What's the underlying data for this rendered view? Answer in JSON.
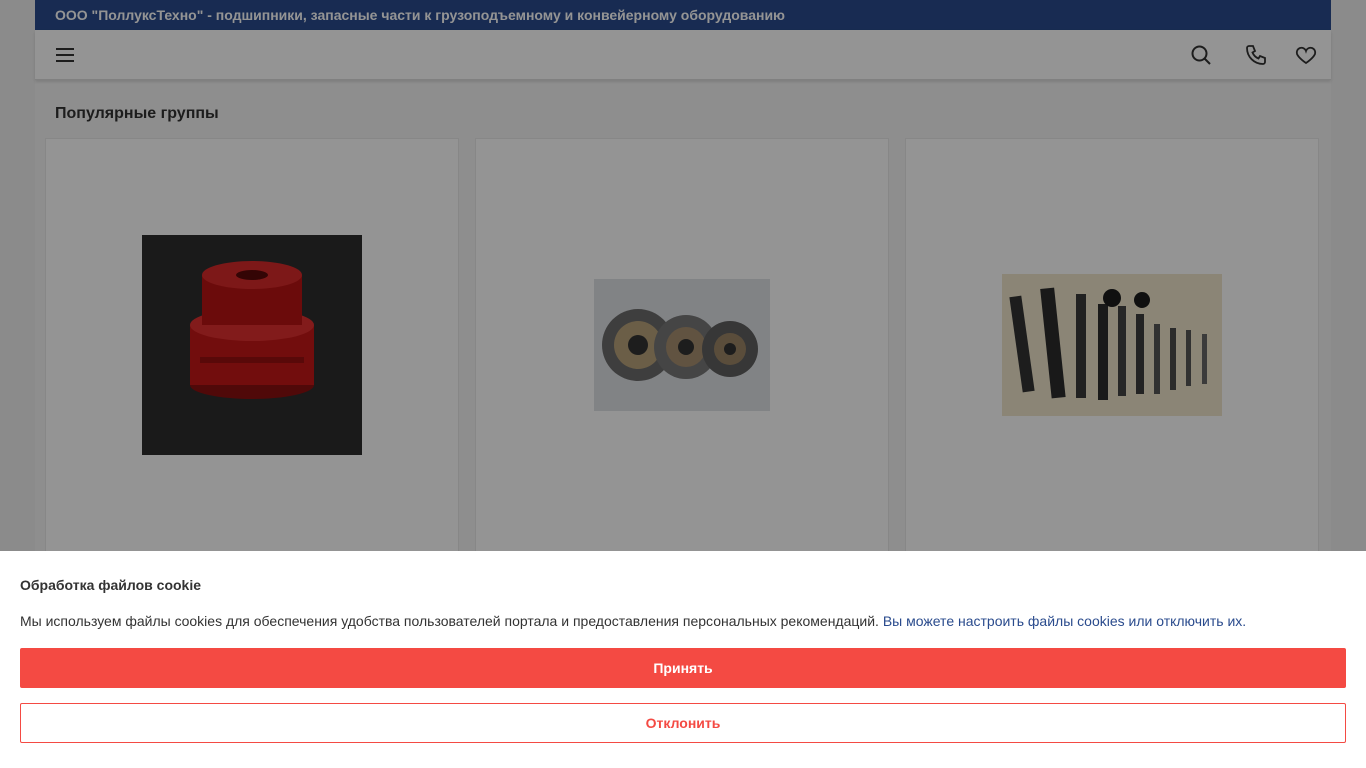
{
  "topbar": {
    "title": "ООО \"ПоллуксТехно\" - подшипники, запасные части к грузоподъемному и конвейерному оборудованию",
    "bg_color": "#2a4b8d"
  },
  "navbar": {
    "icons": [
      "menu-icon",
      "search-icon",
      "phone-icon",
      "heart-icon"
    ]
  },
  "section": {
    "title": "Популярные группы"
  },
  "cards": [
    {
      "image": "red-gear-coupling"
    },
    {
      "image": "electromagnetic-clutches"
    },
    {
      "image": "shafts-set"
    }
  ],
  "cookie": {
    "title": "Обработка файлов cookie",
    "text": "Мы используем файлы cookies для обеспечения удобства пользователей портала и предоставления персональных рекомендаций.",
    "link": "Вы можете настроить файлы cookies или отключить их.",
    "accept_label": "Принять",
    "decline_label": "Отклонить",
    "accent_color": "#f44a43"
  }
}
